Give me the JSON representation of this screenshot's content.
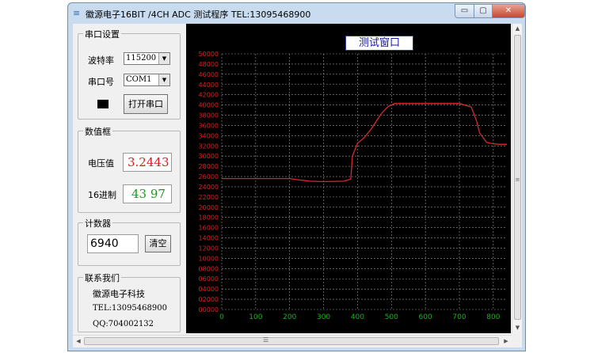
{
  "window": {
    "title": "徽源电子16BIT /4CH ADC 测试程序 TEL:13095468900",
    "min_glyph": "▭",
    "max_glyph": "▢",
    "close_glyph": "✕"
  },
  "serial": {
    "group_title": "串口设置",
    "baud_label": "波特率",
    "baud_value": "115200",
    "port_label": "串口号",
    "port_value": "COM1",
    "open_button": "打开串口"
  },
  "values": {
    "group_title": "数值框",
    "voltage_label": "电压值",
    "voltage_value": "3.2443",
    "hex_label": "16进制",
    "hex_value": "43 97"
  },
  "counter": {
    "group_title": "计数器",
    "count_value": "6940",
    "clear_button": "清空"
  },
  "contact": {
    "group_title": "联系我们",
    "company": "徽源电子科技",
    "tel": "TEL:13095468900",
    "qq": "QQ:704002132"
  },
  "colors": {
    "chart_bg": "#000000",
    "grid": "#9a9a9a",
    "y_ticks": "#e02020",
    "x_ticks": "#1db01d",
    "series": "#d42a2a",
    "voltage_text": "#d41e1e",
    "hex_text": "#1a9a1a"
  },
  "chart_data": {
    "type": "line",
    "title": "测试窗口",
    "xlim": [
      0,
      840
    ],
    "ylim": [
      0,
      50000
    ],
    "x_ticks": [
      "0",
      "100",
      "200",
      "300",
      "400",
      "500",
      "600",
      "700",
      "800"
    ],
    "y_ticks": [
      "00000",
      "02000",
      "04000",
      "06000",
      "08000",
      "10000",
      "12000",
      "14000",
      "16000",
      "18000",
      "20000",
      "22000",
      "24000",
      "26000",
      "28000",
      "30000",
      "32000",
      "34000",
      "36000",
      "38000",
      "40000",
      "42000",
      "44000",
      "46000",
      "48000",
      "50000"
    ],
    "grid": true,
    "series": [
      {
        "x": [
          0,
          200,
          220,
          260,
          300,
          360,
          380,
          385,
          400,
          420,
          440,
          470,
          490,
          510,
          600,
          700,
          735,
          750,
          760,
          780,
          800,
          820,
          840
        ],
        "y": [
          25600,
          25600,
          25400,
          25100,
          25000,
          25100,
          25500,
          30000,
          32500,
          33600,
          35300,
          38300,
          39700,
          40300,
          40300,
          40300,
          39600,
          37000,
          34500,
          32700,
          32400,
          32300,
          32300
        ]
      }
    ]
  }
}
